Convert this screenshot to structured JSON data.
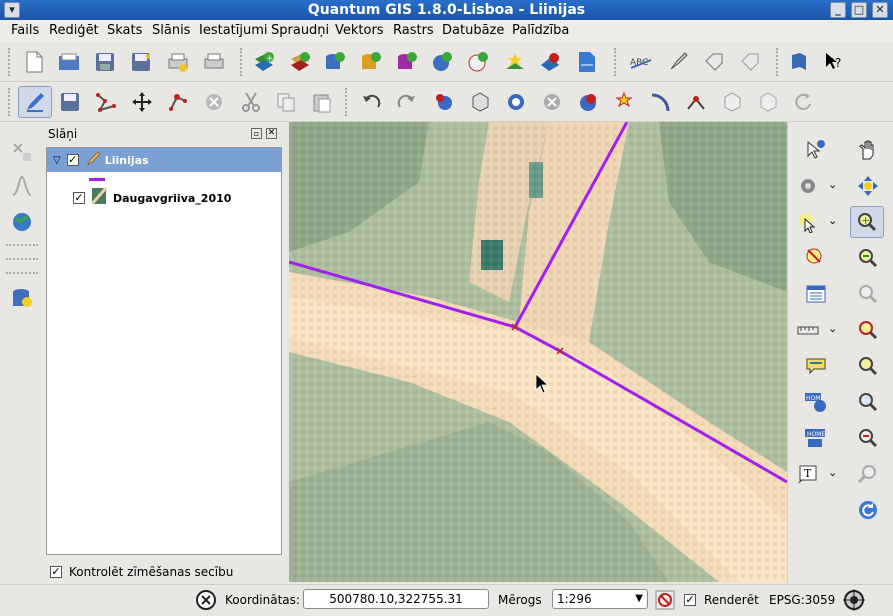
{
  "window": {
    "title": "Quantum GIS 1.8.0-Lisboa - Liinijas"
  },
  "menu": [
    "Fails",
    "Rediģēt",
    "Skats",
    "Slānis",
    "Iestatījumi",
    "Spraudņi",
    "Vektors",
    "Rastrs",
    "Datubāze",
    "Palīdzība"
  ],
  "layers_panel": {
    "title": "Slāņi",
    "layers": [
      {
        "name": "Liinijas",
        "checked": true,
        "selected": true,
        "type": "line",
        "color": "#a020f0"
      },
      {
        "name": "Daugavgriiva_2010",
        "checked": true,
        "selected": false,
        "type": "raster"
      }
    ],
    "render_order_label": "Kontrolēt zīmēšanas secību",
    "render_order_checked": true
  },
  "status": {
    "coord_label": "Koordinātas:",
    "coord_value": "500780.10,322755.31",
    "scale_label": "Mērogs",
    "scale_value": "1:296",
    "render_label": "Renderēt",
    "render_checked": true,
    "crs": "EPSG:3059"
  },
  "colors": {
    "title_bar": "#1f5fb8",
    "selection": "#7aa0d4",
    "line_feature": "#a020f0",
    "road": "#f5dcb8"
  }
}
